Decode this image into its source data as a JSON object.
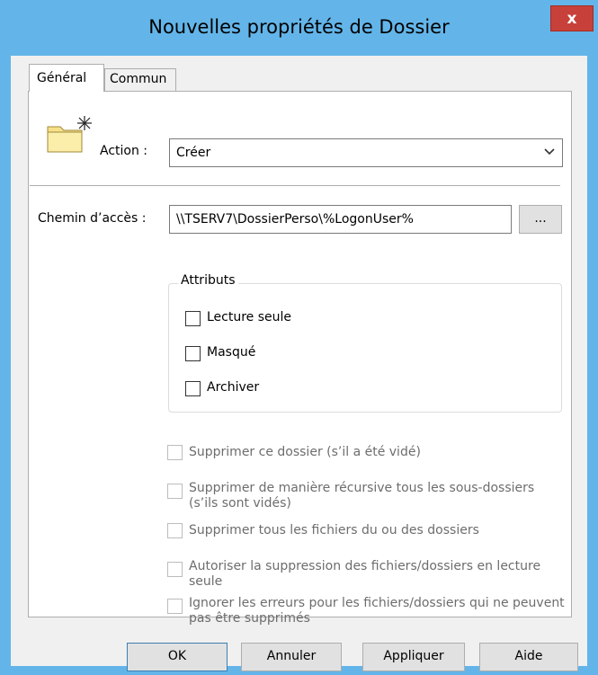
{
  "window": {
    "title": "Nouvelles propriétés de Dossier",
    "close_label": "x"
  },
  "tabs": [
    {
      "label": "Général",
      "active": true
    },
    {
      "label": "Commun",
      "active": false
    }
  ],
  "general": {
    "icon": "folder-new-icon",
    "action_label": "Action :",
    "action_value": "Créer",
    "path_label": "Chemin d’accès :",
    "path_value": "\\\\TSERV7\\DossierPerso\\%LogonUser%",
    "browse_label": "...",
    "attributes": {
      "title": "Attributs",
      "items": [
        {
          "label": "Lecture seule",
          "checked": false
        },
        {
          "label": "Masqué",
          "checked": false
        },
        {
          "label": "Archiver",
          "checked": false
        }
      ]
    },
    "options": [
      {
        "label": "Supprimer ce dossier (s’il a été vidé)",
        "checked": false,
        "enabled": false
      },
      {
        "label": "Supprimer de manière récursive tous les sous-dossiers (s’ils sont vidés)",
        "checked": false,
        "enabled": false
      },
      {
        "label": "Supprimer tous les fichiers du ou des dossiers",
        "checked": false,
        "enabled": false
      },
      {
        "label": "Autoriser la suppression des fichiers/dossiers en lecture seule",
        "checked": false,
        "enabled": false
      },
      {
        "label": "Ignorer les erreurs pour les fichiers/dossiers qui ne peuvent pas être supprimés",
        "checked": false,
        "enabled": false
      }
    ]
  },
  "buttons": {
    "ok": "OK",
    "cancel": "Annuler",
    "apply": "Appliquer",
    "help": "Aide"
  },
  "colors": {
    "frame": "#63b5e9",
    "close": "#c7413a"
  }
}
